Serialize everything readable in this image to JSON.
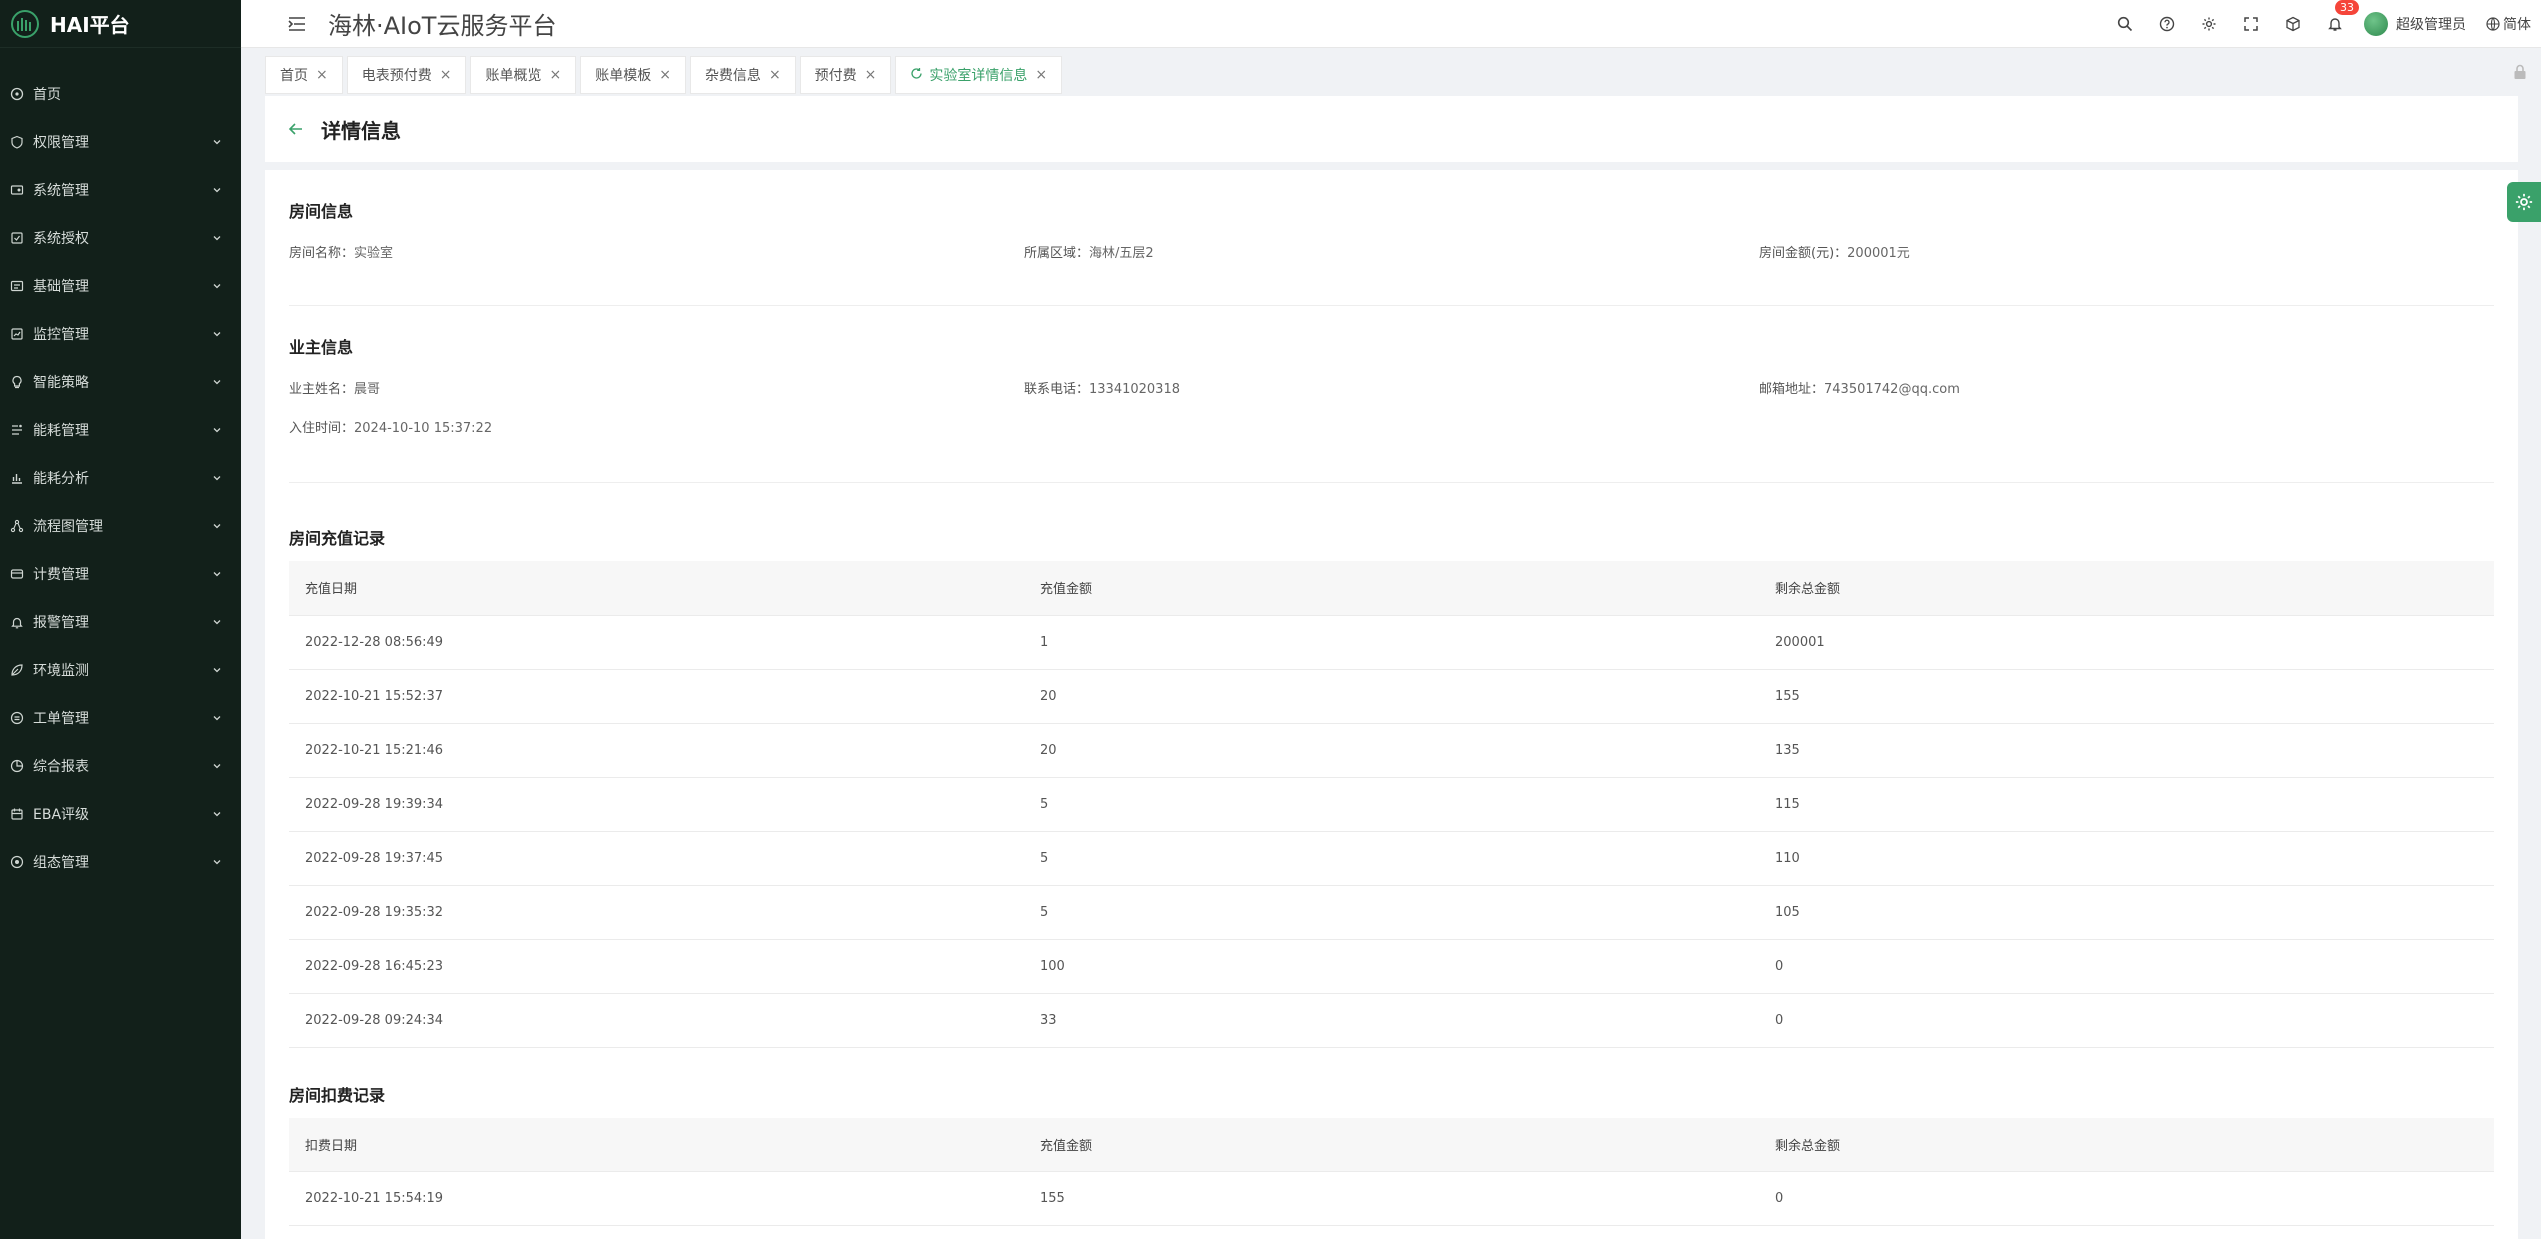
{
  "app": {
    "brand": "HAI平台",
    "title": "海林·AIoT云服务平台"
  },
  "sidebar": {
    "items": [
      {
        "label": "首页",
        "icon": "home-icon",
        "has_children": false
      },
      {
        "label": "权限管理",
        "icon": "shield-icon",
        "has_children": true
      },
      {
        "label": "系统管理",
        "icon": "system-icon",
        "has_children": true
      },
      {
        "label": "系统授权",
        "icon": "authorize-icon",
        "has_children": true
      },
      {
        "label": "基础管理",
        "icon": "basic-icon",
        "has_children": true
      },
      {
        "label": "监控管理",
        "icon": "monitor-icon",
        "has_children": true
      },
      {
        "label": "智能策略",
        "icon": "bulb-icon",
        "has_children": true
      },
      {
        "label": "能耗管理",
        "icon": "energy-icon",
        "has_children": true
      },
      {
        "label": "能耗分析",
        "icon": "chart-icon",
        "has_children": true
      },
      {
        "label": "流程图管理",
        "icon": "flow-icon",
        "has_children": true
      },
      {
        "label": "计费管理",
        "icon": "billing-icon",
        "has_children": true
      },
      {
        "label": "报警管理",
        "icon": "alarm-icon",
        "has_children": true
      },
      {
        "label": "环境监测",
        "icon": "leaf-icon",
        "has_children": true
      },
      {
        "label": "工单管理",
        "icon": "order-icon",
        "has_children": true
      },
      {
        "label": "综合报表",
        "icon": "report-icon",
        "has_children": true
      },
      {
        "label": "EBA评级",
        "icon": "rating-icon",
        "has_children": true
      },
      {
        "label": "组态管理",
        "icon": "config-icon",
        "has_children": true
      }
    ]
  },
  "header": {
    "notification_count": "33",
    "user_name": "超级管理员",
    "language": "简体"
  },
  "tabs": [
    {
      "label": "首页",
      "active": false
    },
    {
      "label": "电表预付费",
      "active": false
    },
    {
      "label": "账单概览",
      "active": false
    },
    {
      "label": "账单模板",
      "active": false
    },
    {
      "label": "杂费信息",
      "active": false
    },
    {
      "label": "预付费",
      "active": false
    },
    {
      "label": "实验室详情信息",
      "active": true
    }
  ],
  "page": {
    "title": "详情信息"
  },
  "room_info": {
    "title": "房间信息",
    "name_label": "房间名称：",
    "name": "实验室",
    "area_label": "所属区域：",
    "area": "海林/五层2",
    "amount_label": "房间金额(元)：",
    "amount": "200001元"
  },
  "owner_info": {
    "title": "业主信息",
    "name_label": "业主姓名：",
    "name": "晨哥",
    "phone_label": "联系电话：",
    "phone": "13341020318",
    "email_label": "邮箱地址：",
    "email": "743501742@qq.com",
    "checkin_label": "入住时间：",
    "checkin": "2024-10-10 15:37:22"
  },
  "recharge": {
    "title": "房间充值记录",
    "columns": [
      "充值日期",
      "充值金额",
      "剩余总金额"
    ],
    "rows": [
      [
        "2022-12-28 08:56:49",
        "1",
        "200001"
      ],
      [
        "2022-10-21 15:52:37",
        "20",
        "155"
      ],
      [
        "2022-10-21 15:21:46",
        "20",
        "135"
      ],
      [
        "2022-09-28 19:39:34",
        "5",
        "115"
      ],
      [
        "2022-09-28 19:37:45",
        "5",
        "110"
      ],
      [
        "2022-09-28 19:35:32",
        "5",
        "105"
      ],
      [
        "2022-09-28 16:45:23",
        "100",
        "0"
      ],
      [
        "2022-09-28 09:24:34",
        "33",
        "0"
      ]
    ]
  },
  "deduction": {
    "title": "房间扣费记录",
    "columns": [
      "扣费日期",
      "充值金额",
      "剩余总金额"
    ],
    "rows": [
      [
        "2022-10-21 15:54:19",
        "155",
        "0"
      ]
    ]
  },
  "colors": {
    "accent": "#3aa16a",
    "sidebar_bg": "#12201a",
    "badge": "#f5453a"
  }
}
